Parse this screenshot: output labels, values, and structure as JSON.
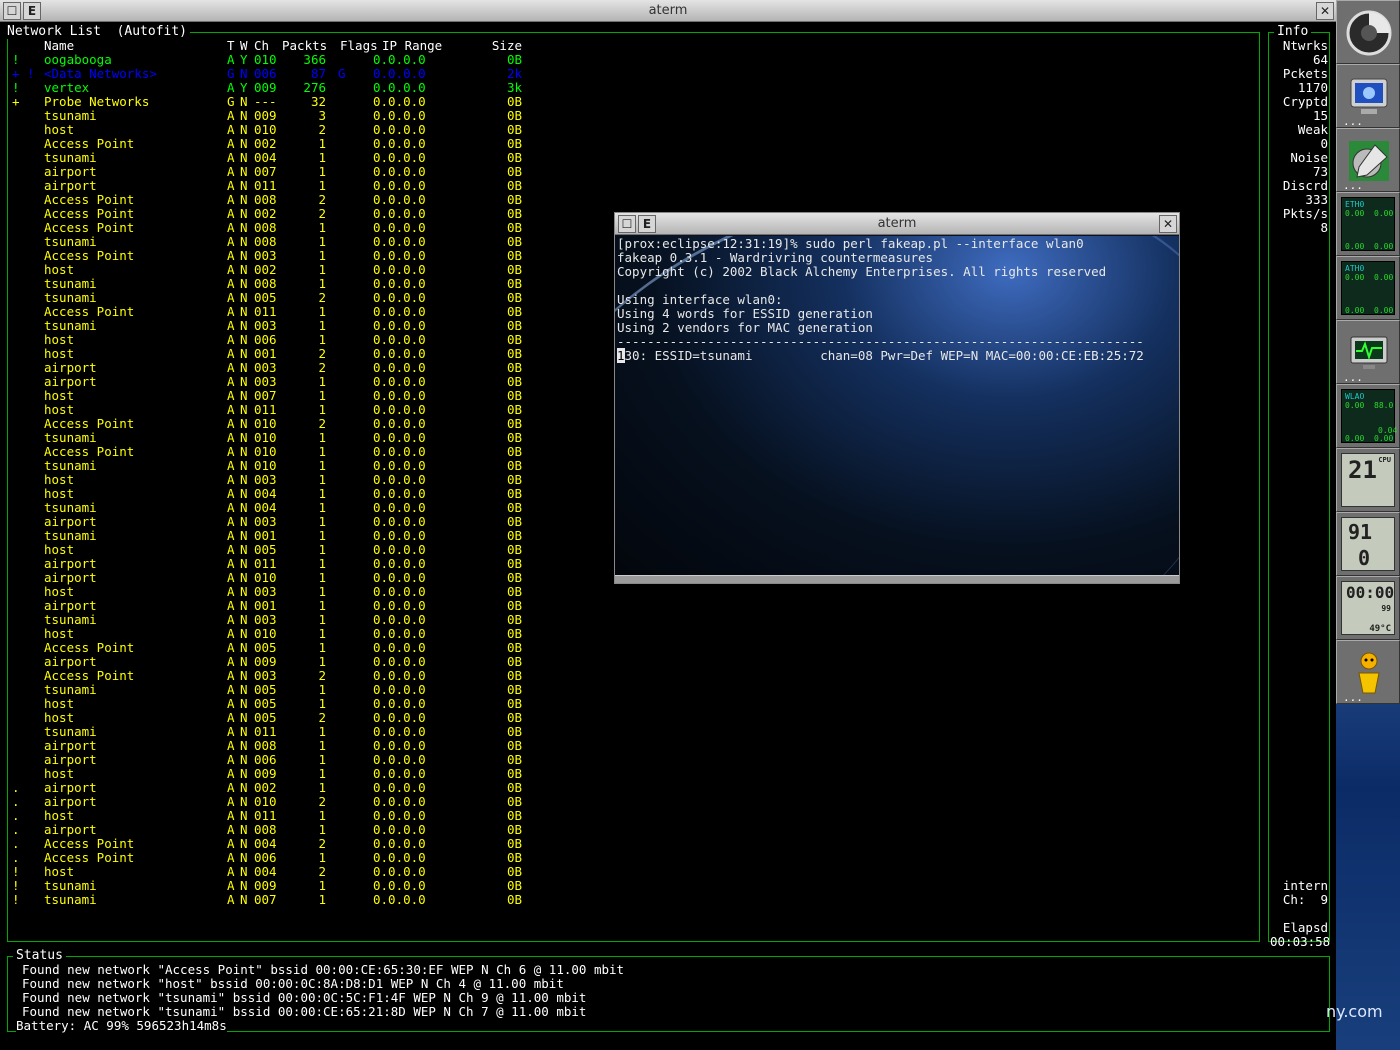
{
  "window": {
    "title": "aterm",
    "btn_min": "",
    "btn_e": "E",
    "btn_close": "✕"
  },
  "network_list": {
    "title": "Network List  (Autofit)",
    "headers": {
      "name": "Name",
      "t": "T",
      "w": "W",
      "ch": "Ch",
      "packets": "Packts",
      "flags": "Flags",
      "ip": "IP Range",
      "size": "Size"
    },
    "rows": [
      {
        "f": "!",
        "n": "oogabooga",
        "t": "A",
        "w": "Y",
        "ch": "010",
        "p": "366",
        "fl": "",
        "ip": "0.0.0.0",
        "s": "0B",
        "c": "grn"
      },
      {
        "f": "+ !",
        "n": "<Data Networks>",
        "t": "G",
        "w": "N",
        "ch": "006",
        "p": "87",
        "fl": "G",
        "ip": "0.0.0.0",
        "s": "2k",
        "c": "blu"
      },
      {
        "f": "!",
        "n": "vertex",
        "t": "A",
        "w": "Y",
        "ch": "009",
        "p": "276",
        "fl": "",
        "ip": "0.0.0.0",
        "s": "3k",
        "c": "grn"
      },
      {
        "f": "+",
        "n": "Probe Networks",
        "t": "G",
        "w": "N",
        "ch": "---",
        "p": "32",
        "fl": "",
        "ip": "0.0.0.0",
        "s": "0B",
        "c": "yel"
      },
      {
        "f": "",
        "n": "tsunami",
        "t": "A",
        "w": "N",
        "ch": "009",
        "p": "3",
        "fl": "",
        "ip": "0.0.0.0",
        "s": "0B",
        "c": "yel"
      },
      {
        "f": "",
        "n": "host",
        "t": "A",
        "w": "N",
        "ch": "010",
        "p": "2",
        "fl": "",
        "ip": "0.0.0.0",
        "s": "0B",
        "c": "yel"
      },
      {
        "f": "",
        "n": "Access Point",
        "t": "A",
        "w": "N",
        "ch": "002",
        "p": "1",
        "fl": "",
        "ip": "0.0.0.0",
        "s": "0B",
        "c": "yel"
      },
      {
        "f": "",
        "n": "tsunami",
        "t": "A",
        "w": "N",
        "ch": "004",
        "p": "1",
        "fl": "",
        "ip": "0.0.0.0",
        "s": "0B",
        "c": "yel"
      },
      {
        "f": "",
        "n": "airport",
        "t": "A",
        "w": "N",
        "ch": "007",
        "p": "1",
        "fl": "",
        "ip": "0.0.0.0",
        "s": "0B",
        "c": "yel"
      },
      {
        "f": "",
        "n": "airport",
        "t": "A",
        "w": "N",
        "ch": "011",
        "p": "1",
        "fl": "",
        "ip": "0.0.0.0",
        "s": "0B",
        "c": "yel"
      },
      {
        "f": "",
        "n": "Access Point",
        "t": "A",
        "w": "N",
        "ch": "008",
        "p": "2",
        "fl": "",
        "ip": "0.0.0.0",
        "s": "0B",
        "c": "yel"
      },
      {
        "f": "",
        "n": "Access Point",
        "t": "A",
        "w": "N",
        "ch": "002",
        "p": "2",
        "fl": "",
        "ip": "0.0.0.0",
        "s": "0B",
        "c": "yel"
      },
      {
        "f": "",
        "n": "Access Point",
        "t": "A",
        "w": "N",
        "ch": "008",
        "p": "1",
        "fl": "",
        "ip": "0.0.0.0",
        "s": "0B",
        "c": "yel"
      },
      {
        "f": "",
        "n": "tsunami",
        "t": "A",
        "w": "N",
        "ch": "008",
        "p": "1",
        "fl": "",
        "ip": "0.0.0.0",
        "s": "0B",
        "c": "yel"
      },
      {
        "f": "",
        "n": "Access Point",
        "t": "A",
        "w": "N",
        "ch": "003",
        "p": "1",
        "fl": "",
        "ip": "0.0.0.0",
        "s": "0B",
        "c": "yel"
      },
      {
        "f": "",
        "n": "host",
        "t": "A",
        "w": "N",
        "ch": "002",
        "p": "1",
        "fl": "",
        "ip": "0.0.0.0",
        "s": "0B",
        "c": "yel"
      },
      {
        "f": "",
        "n": "tsunami",
        "t": "A",
        "w": "N",
        "ch": "008",
        "p": "1",
        "fl": "",
        "ip": "0.0.0.0",
        "s": "0B",
        "c": "yel"
      },
      {
        "f": "",
        "n": "tsunami",
        "t": "A",
        "w": "N",
        "ch": "005",
        "p": "2",
        "fl": "",
        "ip": "0.0.0.0",
        "s": "0B",
        "c": "yel"
      },
      {
        "f": "",
        "n": "Access Point",
        "t": "A",
        "w": "N",
        "ch": "011",
        "p": "1",
        "fl": "",
        "ip": "0.0.0.0",
        "s": "0B",
        "c": "yel"
      },
      {
        "f": "",
        "n": "tsunami",
        "t": "A",
        "w": "N",
        "ch": "003",
        "p": "1",
        "fl": "",
        "ip": "0.0.0.0",
        "s": "0B",
        "c": "yel"
      },
      {
        "f": "",
        "n": "host",
        "t": "A",
        "w": "N",
        "ch": "006",
        "p": "1",
        "fl": "",
        "ip": "0.0.0.0",
        "s": "0B",
        "c": "yel"
      },
      {
        "f": "",
        "n": "host",
        "t": "A",
        "w": "N",
        "ch": "001",
        "p": "2",
        "fl": "",
        "ip": "0.0.0.0",
        "s": "0B",
        "c": "yel"
      },
      {
        "f": "",
        "n": "airport",
        "t": "A",
        "w": "N",
        "ch": "003",
        "p": "2",
        "fl": "",
        "ip": "0.0.0.0",
        "s": "0B",
        "c": "yel"
      },
      {
        "f": "",
        "n": "airport",
        "t": "A",
        "w": "N",
        "ch": "003",
        "p": "1",
        "fl": "",
        "ip": "0.0.0.0",
        "s": "0B",
        "c": "yel"
      },
      {
        "f": "",
        "n": "host",
        "t": "A",
        "w": "N",
        "ch": "007",
        "p": "1",
        "fl": "",
        "ip": "0.0.0.0",
        "s": "0B",
        "c": "yel"
      },
      {
        "f": "",
        "n": "host",
        "t": "A",
        "w": "N",
        "ch": "011",
        "p": "1",
        "fl": "",
        "ip": "0.0.0.0",
        "s": "0B",
        "c": "yel"
      },
      {
        "f": "",
        "n": "Access Point",
        "t": "A",
        "w": "N",
        "ch": "010",
        "p": "2",
        "fl": "",
        "ip": "0.0.0.0",
        "s": "0B",
        "c": "yel"
      },
      {
        "f": "",
        "n": "tsunami",
        "t": "A",
        "w": "N",
        "ch": "010",
        "p": "1",
        "fl": "",
        "ip": "0.0.0.0",
        "s": "0B",
        "c": "yel"
      },
      {
        "f": "",
        "n": "Access Point",
        "t": "A",
        "w": "N",
        "ch": "010",
        "p": "1",
        "fl": "",
        "ip": "0.0.0.0",
        "s": "0B",
        "c": "yel"
      },
      {
        "f": "",
        "n": "tsunami",
        "t": "A",
        "w": "N",
        "ch": "010",
        "p": "1",
        "fl": "",
        "ip": "0.0.0.0",
        "s": "0B",
        "c": "yel"
      },
      {
        "f": "",
        "n": "host",
        "t": "A",
        "w": "N",
        "ch": "003",
        "p": "1",
        "fl": "",
        "ip": "0.0.0.0",
        "s": "0B",
        "c": "yel"
      },
      {
        "f": "",
        "n": "host",
        "t": "A",
        "w": "N",
        "ch": "004",
        "p": "1",
        "fl": "",
        "ip": "0.0.0.0",
        "s": "0B",
        "c": "yel"
      },
      {
        "f": "",
        "n": "tsunami",
        "t": "A",
        "w": "N",
        "ch": "004",
        "p": "1",
        "fl": "",
        "ip": "0.0.0.0",
        "s": "0B",
        "c": "yel"
      },
      {
        "f": "",
        "n": "airport",
        "t": "A",
        "w": "N",
        "ch": "003",
        "p": "1",
        "fl": "",
        "ip": "0.0.0.0",
        "s": "0B",
        "c": "yel"
      },
      {
        "f": "",
        "n": "tsunami",
        "t": "A",
        "w": "N",
        "ch": "001",
        "p": "1",
        "fl": "",
        "ip": "0.0.0.0",
        "s": "0B",
        "c": "yel"
      },
      {
        "f": "",
        "n": "host",
        "t": "A",
        "w": "N",
        "ch": "005",
        "p": "1",
        "fl": "",
        "ip": "0.0.0.0",
        "s": "0B",
        "c": "yel"
      },
      {
        "f": "",
        "n": "airport",
        "t": "A",
        "w": "N",
        "ch": "011",
        "p": "1",
        "fl": "",
        "ip": "0.0.0.0",
        "s": "0B",
        "c": "yel"
      },
      {
        "f": "",
        "n": "airport",
        "t": "A",
        "w": "N",
        "ch": "010",
        "p": "1",
        "fl": "",
        "ip": "0.0.0.0",
        "s": "0B",
        "c": "yel"
      },
      {
        "f": "",
        "n": "host",
        "t": "A",
        "w": "N",
        "ch": "003",
        "p": "1",
        "fl": "",
        "ip": "0.0.0.0",
        "s": "0B",
        "c": "yel"
      },
      {
        "f": "",
        "n": "airport",
        "t": "A",
        "w": "N",
        "ch": "001",
        "p": "1",
        "fl": "",
        "ip": "0.0.0.0",
        "s": "0B",
        "c": "yel"
      },
      {
        "f": "",
        "n": "tsunami",
        "t": "A",
        "w": "N",
        "ch": "003",
        "p": "1",
        "fl": "",
        "ip": "0.0.0.0",
        "s": "0B",
        "c": "yel"
      },
      {
        "f": "",
        "n": "host",
        "t": "A",
        "w": "N",
        "ch": "010",
        "p": "1",
        "fl": "",
        "ip": "0.0.0.0",
        "s": "0B",
        "c": "yel"
      },
      {
        "f": "",
        "n": "Access Point",
        "t": "A",
        "w": "N",
        "ch": "005",
        "p": "1",
        "fl": "",
        "ip": "0.0.0.0",
        "s": "0B",
        "c": "yel"
      },
      {
        "f": "",
        "n": "airport",
        "t": "A",
        "w": "N",
        "ch": "009",
        "p": "1",
        "fl": "",
        "ip": "0.0.0.0",
        "s": "0B",
        "c": "yel"
      },
      {
        "f": "",
        "n": "Access Point",
        "t": "A",
        "w": "N",
        "ch": "003",
        "p": "2",
        "fl": "",
        "ip": "0.0.0.0",
        "s": "0B",
        "c": "yel"
      },
      {
        "f": "",
        "n": "tsunami",
        "t": "A",
        "w": "N",
        "ch": "005",
        "p": "1",
        "fl": "",
        "ip": "0.0.0.0",
        "s": "0B",
        "c": "yel"
      },
      {
        "f": "",
        "n": "host",
        "t": "A",
        "w": "N",
        "ch": "005",
        "p": "1",
        "fl": "",
        "ip": "0.0.0.0",
        "s": "0B",
        "c": "yel"
      },
      {
        "f": "",
        "n": "host",
        "t": "A",
        "w": "N",
        "ch": "005",
        "p": "2",
        "fl": "",
        "ip": "0.0.0.0",
        "s": "0B",
        "c": "yel"
      },
      {
        "f": "",
        "n": "tsunami",
        "t": "A",
        "w": "N",
        "ch": "011",
        "p": "1",
        "fl": "",
        "ip": "0.0.0.0",
        "s": "0B",
        "c": "yel"
      },
      {
        "f": "",
        "n": "airport",
        "t": "A",
        "w": "N",
        "ch": "008",
        "p": "1",
        "fl": "",
        "ip": "0.0.0.0",
        "s": "0B",
        "c": "yel"
      },
      {
        "f": "",
        "n": "airport",
        "t": "A",
        "w": "N",
        "ch": "006",
        "p": "1",
        "fl": "",
        "ip": "0.0.0.0",
        "s": "0B",
        "c": "yel"
      },
      {
        "f": "",
        "n": "host",
        "t": "A",
        "w": "N",
        "ch": "009",
        "p": "1",
        "fl": "",
        "ip": "0.0.0.0",
        "s": "0B",
        "c": "yel"
      },
      {
        "f": ".",
        "n": "airport",
        "t": "A",
        "w": "N",
        "ch": "002",
        "p": "1",
        "fl": "",
        "ip": "0.0.0.0",
        "s": "0B",
        "c": "yel"
      },
      {
        "f": ".",
        "n": "airport",
        "t": "A",
        "w": "N",
        "ch": "010",
        "p": "2",
        "fl": "",
        "ip": "0.0.0.0",
        "s": "0B",
        "c": "yel"
      },
      {
        "f": ".",
        "n": "host",
        "t": "A",
        "w": "N",
        "ch": "011",
        "p": "1",
        "fl": "",
        "ip": "0.0.0.0",
        "s": "0B",
        "c": "yel"
      },
      {
        "f": ".",
        "n": "airport",
        "t": "A",
        "w": "N",
        "ch": "008",
        "p": "1",
        "fl": "",
        "ip": "0.0.0.0",
        "s": "0B",
        "c": "yel"
      },
      {
        "f": ".",
        "n": "Access Point",
        "t": "A",
        "w": "N",
        "ch": "004",
        "p": "2",
        "fl": "",
        "ip": "0.0.0.0",
        "s": "0B",
        "c": "yel"
      },
      {
        "f": ".",
        "n": "Access Point",
        "t": "A",
        "w": "N",
        "ch": "006",
        "p": "1",
        "fl": "",
        "ip": "0.0.0.0",
        "s": "0B",
        "c": "yel"
      },
      {
        "f": "!",
        "n": "host",
        "t": "A",
        "w": "N",
        "ch": "004",
        "p": "2",
        "fl": "",
        "ip": "0.0.0.0",
        "s": "0B",
        "c": "yel"
      },
      {
        "f": "!",
        "n": "tsunami",
        "t": "A",
        "w": "N",
        "ch": "009",
        "p": "1",
        "fl": "",
        "ip": "0.0.0.0",
        "s": "0B",
        "c": "yel"
      },
      {
        "f": "!",
        "n": "tsunami",
        "t": "A",
        "w": "N",
        "ch": "007",
        "p": "1",
        "fl": "",
        "ip": "0.0.0.0",
        "s": "0B",
        "c": "yel"
      }
    ]
  },
  "info": {
    "title": "Info",
    "lines": [
      "Ntwrks",
      "64",
      "Pckets",
      "1170",
      "Cryptd",
      "15",
      "Weak",
      "0",
      "Noise",
      "73",
      "Discrd",
      "333",
      "Pkts/s",
      "8"
    ],
    "iface_lines": [
      "intern",
      "Ch:  9"
    ],
    "elapsed_lines": [
      "Elapsd",
      "00:03:58"
    ]
  },
  "status": {
    "title": "Status",
    "lines": [
      "Found new network \"Access Point\" bssid 00:00:CE:65:30:EF WEP N Ch 6 @ 11.00 mbit",
      "Found new network \"host\" bssid 00:00:0C:8A:D8:D1 WEP N Ch 4 @ 11.00 mbit",
      "Found new network \"tsunami\" bssid 00:00:0C:5C:F1:4F WEP N Ch 9 @ 11.00 mbit",
      "Found new network \"tsunami\" bssid 00:00:CE:65:21:8D WEP N Ch 7 @ 11.00 mbit"
    ],
    "battery": "Battery: AC 99% 596523h14m8s"
  },
  "aterm2": {
    "title": "aterm",
    "lines": [
      "[prox:eclipse:12:31:19]% sudo perl fakeap.pl --interface wlan0",
      "fakeap 0.3.1 - Wardrivring countermeasures",
      "Copyright (c) 2002 Black Alchemy Enterprises. All rights reserved",
      "",
      "Using interface wlan0:",
      "Using 4 words for ESSID generation",
      "Using 2 vendors for MAC generation",
      "----------------------------------------------------------------------"
    ],
    "cursor_char": "1",
    "last_line_rest": "30: ESSID=tsunami         chan=08 Pwr=Def WEP=N MAC=00:00:CE:EB:25:72"
  },
  "dock": {
    "eth0_label_1": "ETH0",
    "eth0_val_1": "0.00",
    "eth0_val_1b": "0.00",
    "eth0_label_2": "ATH0",
    "wlan_label": "WLAO",
    "wlan_val": "88.0",
    "wlan_val_2": "0.04",
    "cpu_value": "21",
    "cpu_label": "CPU",
    "mem_value_1": "91",
    "mem_value_2": "0",
    "clock_value": "00:00",
    "batt_percent": "99",
    "temp_value": "49°C",
    "ellipsis": "..."
  },
  "watermark": "ny.com",
  "colors": {
    "border": "#00a800",
    "yellow": "#ffff00",
    "green": "#00ff00",
    "blue": "#0000ff"
  }
}
